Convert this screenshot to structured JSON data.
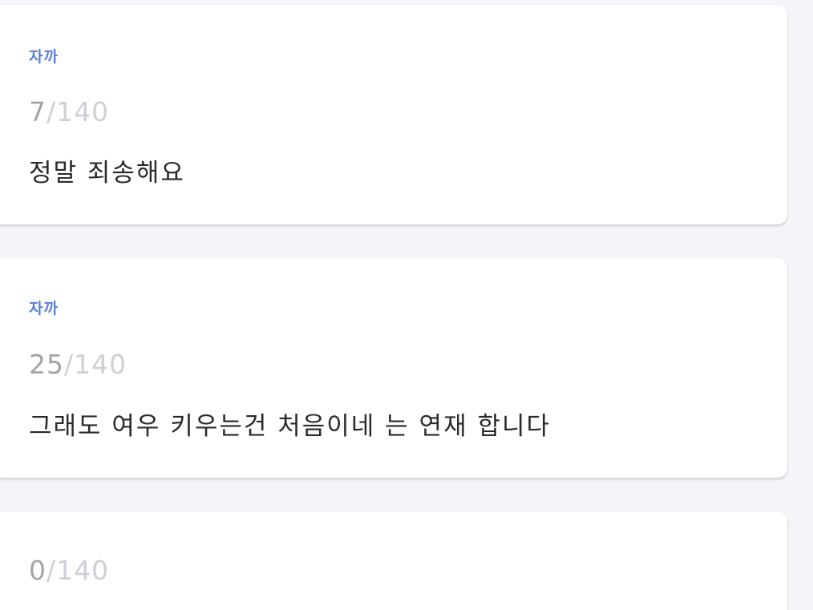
{
  "comments": [
    {
      "author": "자까",
      "count": "7",
      "separator": "/",
      "max": "140",
      "text": "정말 죄송해요"
    },
    {
      "author": "자까",
      "count": "25",
      "separator": "/",
      "max": "140",
      "text": "그래도 여우 키우는건 처음이네 는 연재 합니다"
    },
    {
      "count": "0",
      "separator": "/",
      "max": "140"
    }
  ],
  "colors": {
    "background": "#f4f5f8",
    "card": "#ffffff",
    "author": "#5a7ee0",
    "counter_current": "#a4a4a8",
    "counter_max": "#cdd0d6",
    "text": "#2a2a2c"
  }
}
